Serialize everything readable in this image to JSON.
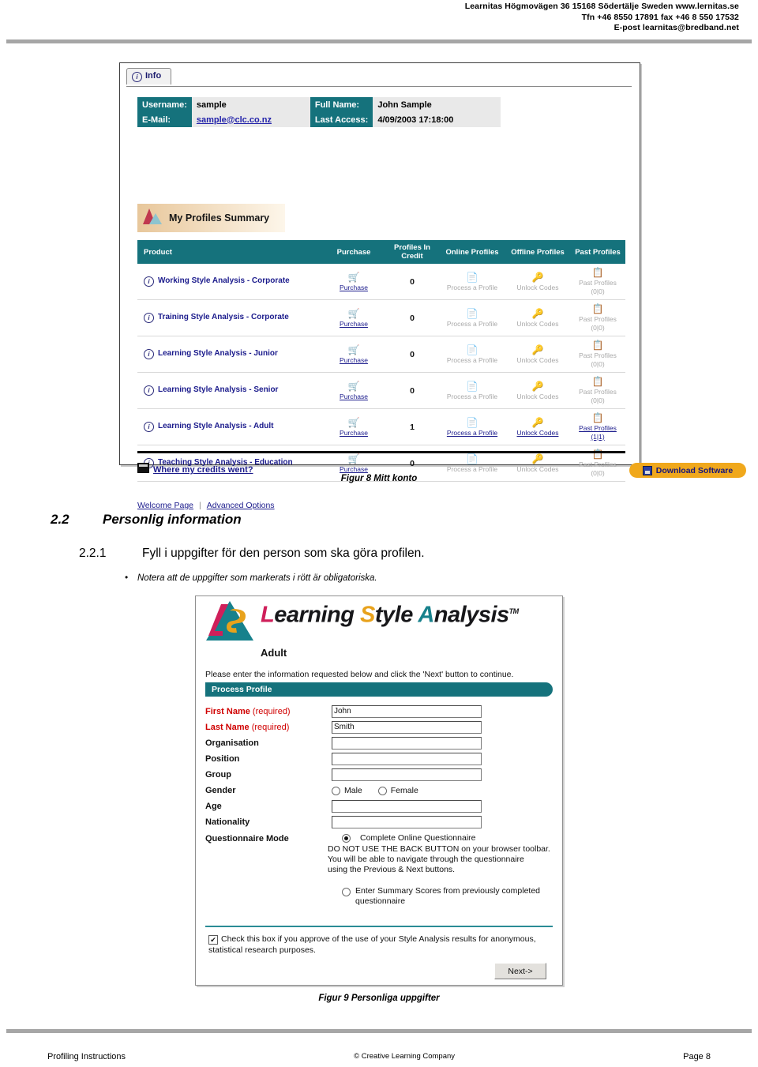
{
  "header": {
    "line1": "Learnitas Högmovägen 36 15168 Södertälje Sweden www.lernitas.se",
    "line2": "Tfn +46 8550 17891 fax +46 8 550 17532",
    "line3": "E-post learnitas@bredband.net"
  },
  "account_screenshot": {
    "tab_label": "Info",
    "info": {
      "username_label": "Username:",
      "username_value": "sample",
      "fullname_label": "Full Name:",
      "fullname_value": "John Sample",
      "email_label": "E-Mail:",
      "email_value": "sample@clc.co.nz",
      "lastaccess_label": "Last Access:",
      "lastaccess_value": "4/09/2003 17:18:00"
    },
    "summary_banner": "My Profiles Summary",
    "columns": [
      "Product",
      "Purchase",
      "Profiles In Credit",
      "Online Profiles",
      "Offline Profiles",
      "Past Profiles"
    ],
    "rows": [
      {
        "product": "Working Style Analysis - Corporate",
        "purchase": "Purchase",
        "credit": "0",
        "online": "Process a Profile",
        "offline": "Unlock Codes",
        "past": "Past Profiles",
        "past_count": "(0|0)",
        "enabled": false
      },
      {
        "product": "Training Style Analysis - Corporate",
        "purchase": "Purchase",
        "credit": "0",
        "online": "Process a Profile",
        "offline": "Unlock Codes",
        "past": "Past Profiles",
        "past_count": "(0|0)",
        "enabled": false
      },
      {
        "product": "Learning Style Analysis - Junior",
        "purchase": "Purchase",
        "credit": "0",
        "online": "Process a Profile",
        "offline": "Unlock Codes",
        "past": "Past Profiles",
        "past_count": "(0|0)",
        "enabled": false
      },
      {
        "product": "Learning Style Analysis - Senior",
        "purchase": "Purchase",
        "credit": "0",
        "online": "Process a Profile",
        "offline": "Unlock Codes",
        "past": "Past Profiles",
        "past_count": "(0|0)",
        "enabled": false
      },
      {
        "product": "Learning Style Analysis - Adult",
        "purchase": "Purchase",
        "credit": "1",
        "online": "Process a Profile",
        "offline": "Unlock Codes",
        "past": "Past Profiles",
        "past_count": "(1|1)",
        "enabled": true
      },
      {
        "product": "Teaching Style Analysis - Education",
        "purchase": "Purchase",
        "credit": "0",
        "online": "Process a Profile",
        "offline": "Unlock Codes",
        "past": "Past Profiles",
        "past_count": "(0|0)",
        "enabled": false
      }
    ],
    "credits_link": "Where my credits went?",
    "download_button": "Download Software",
    "welcome_link": "Welcome Page",
    "advanced_link": "Advanced Options"
  },
  "figure8_caption": "Figur 8 Mitt konto",
  "section": {
    "h2_number": "2.2",
    "h2_title": "Personlig information",
    "h3_number": "2.2.1",
    "h3_title": "Fyll i uppgifter för den person som ska göra profilen.",
    "bullet": "Notera att de uppgifter som markerats i rött är obligatoriska."
  },
  "form_screenshot": {
    "logo": {
      "l": "L",
      "earning": "earning",
      "s": "S",
      "tyle": "tyle",
      "a": "A",
      "nalysis": "nalysis",
      "tm": "TM"
    },
    "subtitle": "Adult",
    "instruction": "Please enter the information requested below and click the 'Next' button to continue.",
    "panel_title": "Process Profile",
    "fields": [
      {
        "label": "First Name",
        "suffix": " (required)",
        "required": true,
        "value": "John"
      },
      {
        "label": "Last Name",
        "suffix": " (required)",
        "required": true,
        "value": "Smith"
      },
      {
        "label": "Organisation",
        "suffix": "",
        "required": false,
        "value": ""
      },
      {
        "label": "Position",
        "suffix": "",
        "required": false,
        "value": ""
      },
      {
        "label": "Group",
        "suffix": "",
        "required": false,
        "value": ""
      }
    ],
    "gender_label": "Gender",
    "gender_male": "Male",
    "gender_female": "Female",
    "age_label": "Age",
    "age_value": "",
    "nationality_label": "Nationality",
    "nationality_value": "",
    "qmode_label": "Questionnaire Mode",
    "qmode_option1": "Complete Online Questionnaire",
    "qmode_note1": "DO NOT USE THE BACK BUTTON on your browser toolbar.",
    "qmode_note2": "You will be able to navigate through the questionnaire",
    "qmode_note3": "using the Previous & Next buttons.",
    "qmode_option2": "Enter Summary Scores from previously completed questionnaire",
    "approve_text": "Check this box if you approve of the use of your Style Analysis results for anonymous, statistical research purposes.",
    "next_button": "Next->"
  },
  "figure9_caption": "Figur 9 Personliga uppgifter",
  "footer": {
    "left": "Profiling Instructions",
    "center": "© Creative Learning Company",
    "right": "Page 8"
  },
  "colors": {
    "teal": "#15727c",
    "orange": "#f0a81c",
    "link_navy": "#1b1b8c",
    "required_red": "#d00000",
    "logo_pink": "#cf1f5a",
    "logo_gold": "#e8a21c",
    "logo_teal": "#17818c"
  }
}
